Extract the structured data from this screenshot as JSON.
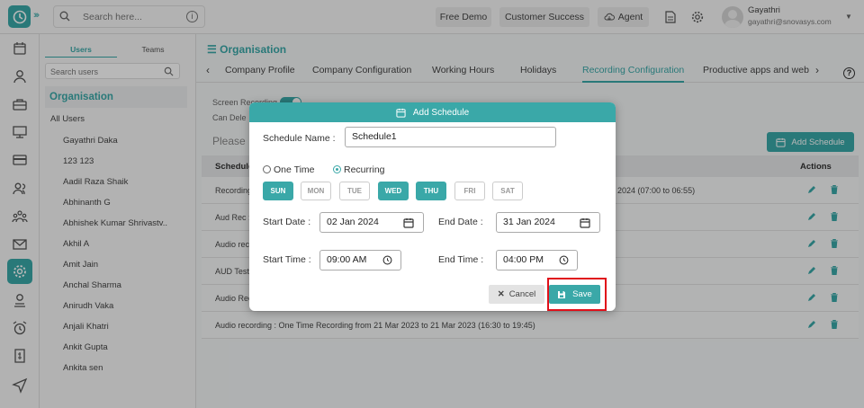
{
  "topbar": {
    "search_placeholder": "Search here...",
    "buttons": [
      "Free Demo",
      "Customer Success",
      "Agent"
    ],
    "user_name": "Gayathri",
    "user_email": "gayathri@snovasys.com"
  },
  "panel": {
    "tabs": [
      "Users",
      "Teams"
    ],
    "search_placeholder": "Search users",
    "org_label": "Organisation",
    "all_users": "All Users",
    "users": [
      "Gayathri Daka",
      "123 123",
      "Aadil Raza Shaik",
      "Abhinanth G",
      "Abhishek Kumar Shrivastv..",
      "Akhil A",
      "Amit Jain",
      "Anchal Sharma",
      "Anirudh Vaka",
      "Anjali Khatri",
      "Ankit Gupta",
      "Ankita sen"
    ]
  },
  "main": {
    "title": "Organisation",
    "tabs": [
      "Company Profile",
      "Company Configuration",
      "Working Hours",
      "Holidays",
      "Recording Configuration",
      "Productive apps and web"
    ],
    "screen_recording_label": "Screen Recording",
    "can_delete_label": "Can Dele",
    "please_text": "Please",
    "add_schedule_button": "Add Schedule",
    "table": {
      "col_schedule": "Schedule",
      "col_actions": "Actions",
      "rows": [
        {
          "left": "Recording",
          "right": "c 2024 (07:00 to 06:55)"
        },
        {
          "left": "Aud Rec :",
          "right": ""
        },
        {
          "left": "Audio reco",
          "right": ""
        },
        {
          "left": "AUD Testi",
          "right": ""
        },
        {
          "left": "Audio Rec",
          "right": ""
        },
        {
          "left": "Audio recording : One Time Recording from 21 Mar 2023 to 21 Mar 2023 (16:30 to 19:45)",
          "right": ""
        }
      ]
    }
  },
  "modal": {
    "title": "Add Schedule",
    "schedule_name_label": "Schedule Name :",
    "schedule_name_value": "Schedule1",
    "radio_one_time": "One Time",
    "radio_recurring": "Recurring",
    "days": [
      {
        "label": "SUN",
        "selected": true
      },
      {
        "label": "MON",
        "selected": false
      },
      {
        "label": "TUE",
        "selected": false
      },
      {
        "label": "WED",
        "selected": true
      },
      {
        "label": "THU",
        "selected": true
      },
      {
        "label": "FRI",
        "selected": false
      },
      {
        "label": "SAT",
        "selected": false
      }
    ],
    "start_date_label": "Start Date :",
    "start_date_value": "02 Jan 2024",
    "end_date_label": "End Date :",
    "end_date_value": "31 Jan 2024",
    "start_time_label": "Start Time :",
    "start_time_value": "09:00 AM",
    "end_time_label": "End Time :",
    "end_time_value": "04:00 PM",
    "cancel_label": "Cancel",
    "save_label": "Save"
  },
  "colors": {
    "accent": "#3aa8a8",
    "highlight": "#e0101a"
  }
}
